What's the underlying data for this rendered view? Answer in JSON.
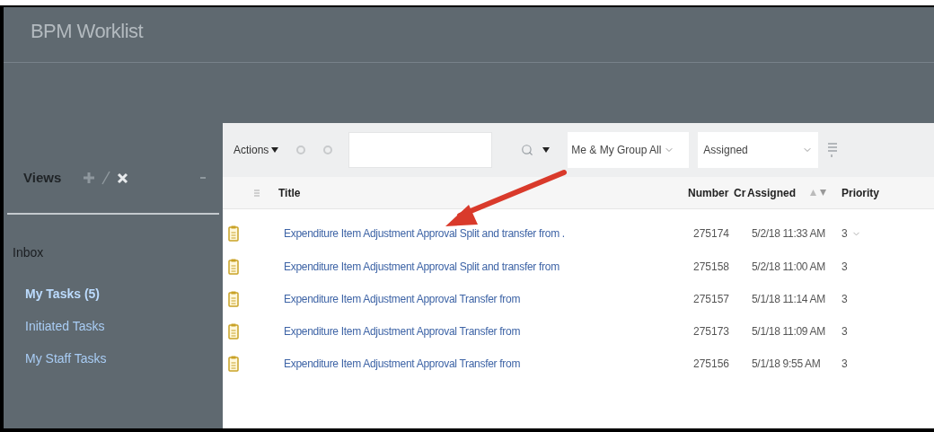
{
  "app_title": "BPM Worklist",
  "sidebar": {
    "title": "Views",
    "sections": [
      {
        "label": "Inbox",
        "items": [
          {
            "label": "My Tasks (5)",
            "selected": true
          },
          {
            "label": "Initiated Tasks",
            "selected": false
          },
          {
            "label": "My Staff Tasks",
            "selected": false
          }
        ]
      }
    ]
  },
  "toolbar": {
    "actions": "Actions",
    "filter_1": "Me & My Group All",
    "filter_2": "Assigned"
  },
  "table": {
    "columns": [
      "Title",
      "Number",
      "Cr",
      "Assigned",
      "Priority"
    ],
    "rows": [
      {
        "title": "Expenditure Item Adjustment Approval Split and transfer from .",
        "number": "275174",
        "assigned": "5/2/18 11:33 AM",
        "priority": "3",
        "priority_menu": true
      },
      {
        "title": "Expenditure Item Adjustment Approval Split and transfer from",
        "number": "275158",
        "assigned": "5/2/18 11:00 AM",
        "priority": "3",
        "priority_menu": false
      },
      {
        "title": "Expenditure Item Adjustment Approval Transfer from",
        "number": "275157",
        "assigned": "5/1/18 11:14 AM",
        "priority": "3",
        "priority_menu": false
      },
      {
        "title": "Expenditure Item Adjustment Approval Transfer from",
        "number": "275173",
        "assigned": "5/1/18 11:09 AM",
        "priority": "3",
        "priority_menu": false
      },
      {
        "title": "Expenditure Item Adjustment Approval Transfer from",
        "number": "275156",
        "assigned": "5/1/18 9:55 AM",
        "priority": "3",
        "priority_menu": false
      }
    ]
  }
}
